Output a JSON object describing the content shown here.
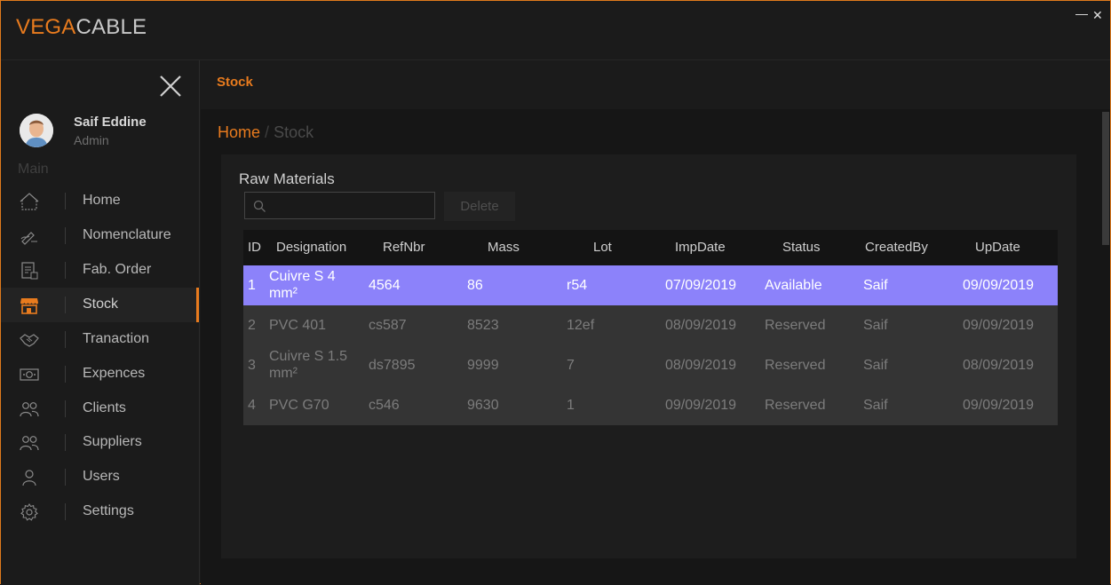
{
  "app": {
    "logo_part1": "VEGA",
    "logo_part2": "CABLE",
    "minimize_glyph": "—",
    "close_glyph": "✕",
    "accent_color": "#e87b1e"
  },
  "sidebar": {
    "user": {
      "name": "Saif Eddine",
      "role": "Admin"
    },
    "section_label": "Main",
    "items": [
      {
        "label": "Home",
        "icon": "home-icon"
      },
      {
        "label": "Nomenclature",
        "icon": "pen-icon"
      },
      {
        "label": "Fab. Order",
        "icon": "order-icon"
      },
      {
        "label": "Stock",
        "icon": "store-icon",
        "active": true
      },
      {
        "label": "Tranaction",
        "icon": "handshake-icon"
      },
      {
        "label": "Expences",
        "icon": "money-icon"
      },
      {
        "label": "Clients",
        "icon": "clients-icon"
      },
      {
        "label": "Suppliers",
        "icon": "suppliers-icon"
      },
      {
        "label": "Users",
        "icon": "user-icon"
      },
      {
        "label": "Settings",
        "icon": "gear-icon"
      }
    ]
  },
  "page": {
    "title": "Stock",
    "breadcrumb": {
      "home": "Home",
      "separator": "/",
      "current": "Stock"
    }
  },
  "card": {
    "title": "Raw Materials",
    "search_placeholder": "",
    "delete_label": "Delete"
  },
  "table": {
    "headers": [
      "ID",
      "Designation",
      "RefNbr",
      "Mass",
      "Lot",
      "ImpDate",
      "Status",
      "CreatedBy",
      "UpDate"
    ],
    "rows": [
      {
        "selected": true,
        "cells": [
          "1",
          "Cuivre S 4 mm²",
          "4564",
          "86",
          "r54",
          "07/09/2019",
          "Available",
          "Saif",
          "09/09/2019"
        ]
      },
      {
        "selected": false,
        "cells": [
          "2",
          "PVC 401",
          "cs587",
          "8523",
          "12ef",
          "08/09/2019",
          "Reserved",
          "Saif",
          "09/09/2019"
        ]
      },
      {
        "selected": false,
        "cells": [
          "3",
          "Cuivre S 1.5 mm²",
          "ds7895",
          "9999",
          "7",
          "08/09/2019",
          "Reserved",
          "Saif",
          "08/09/2019"
        ]
      },
      {
        "selected": false,
        "cells": [
          "4",
          "PVC G70",
          "c546",
          "9630",
          "1",
          "09/09/2019",
          "Reserved",
          "Saif",
          "09/09/2019"
        ]
      }
    ],
    "selected_row_color": "#8c82fa"
  }
}
